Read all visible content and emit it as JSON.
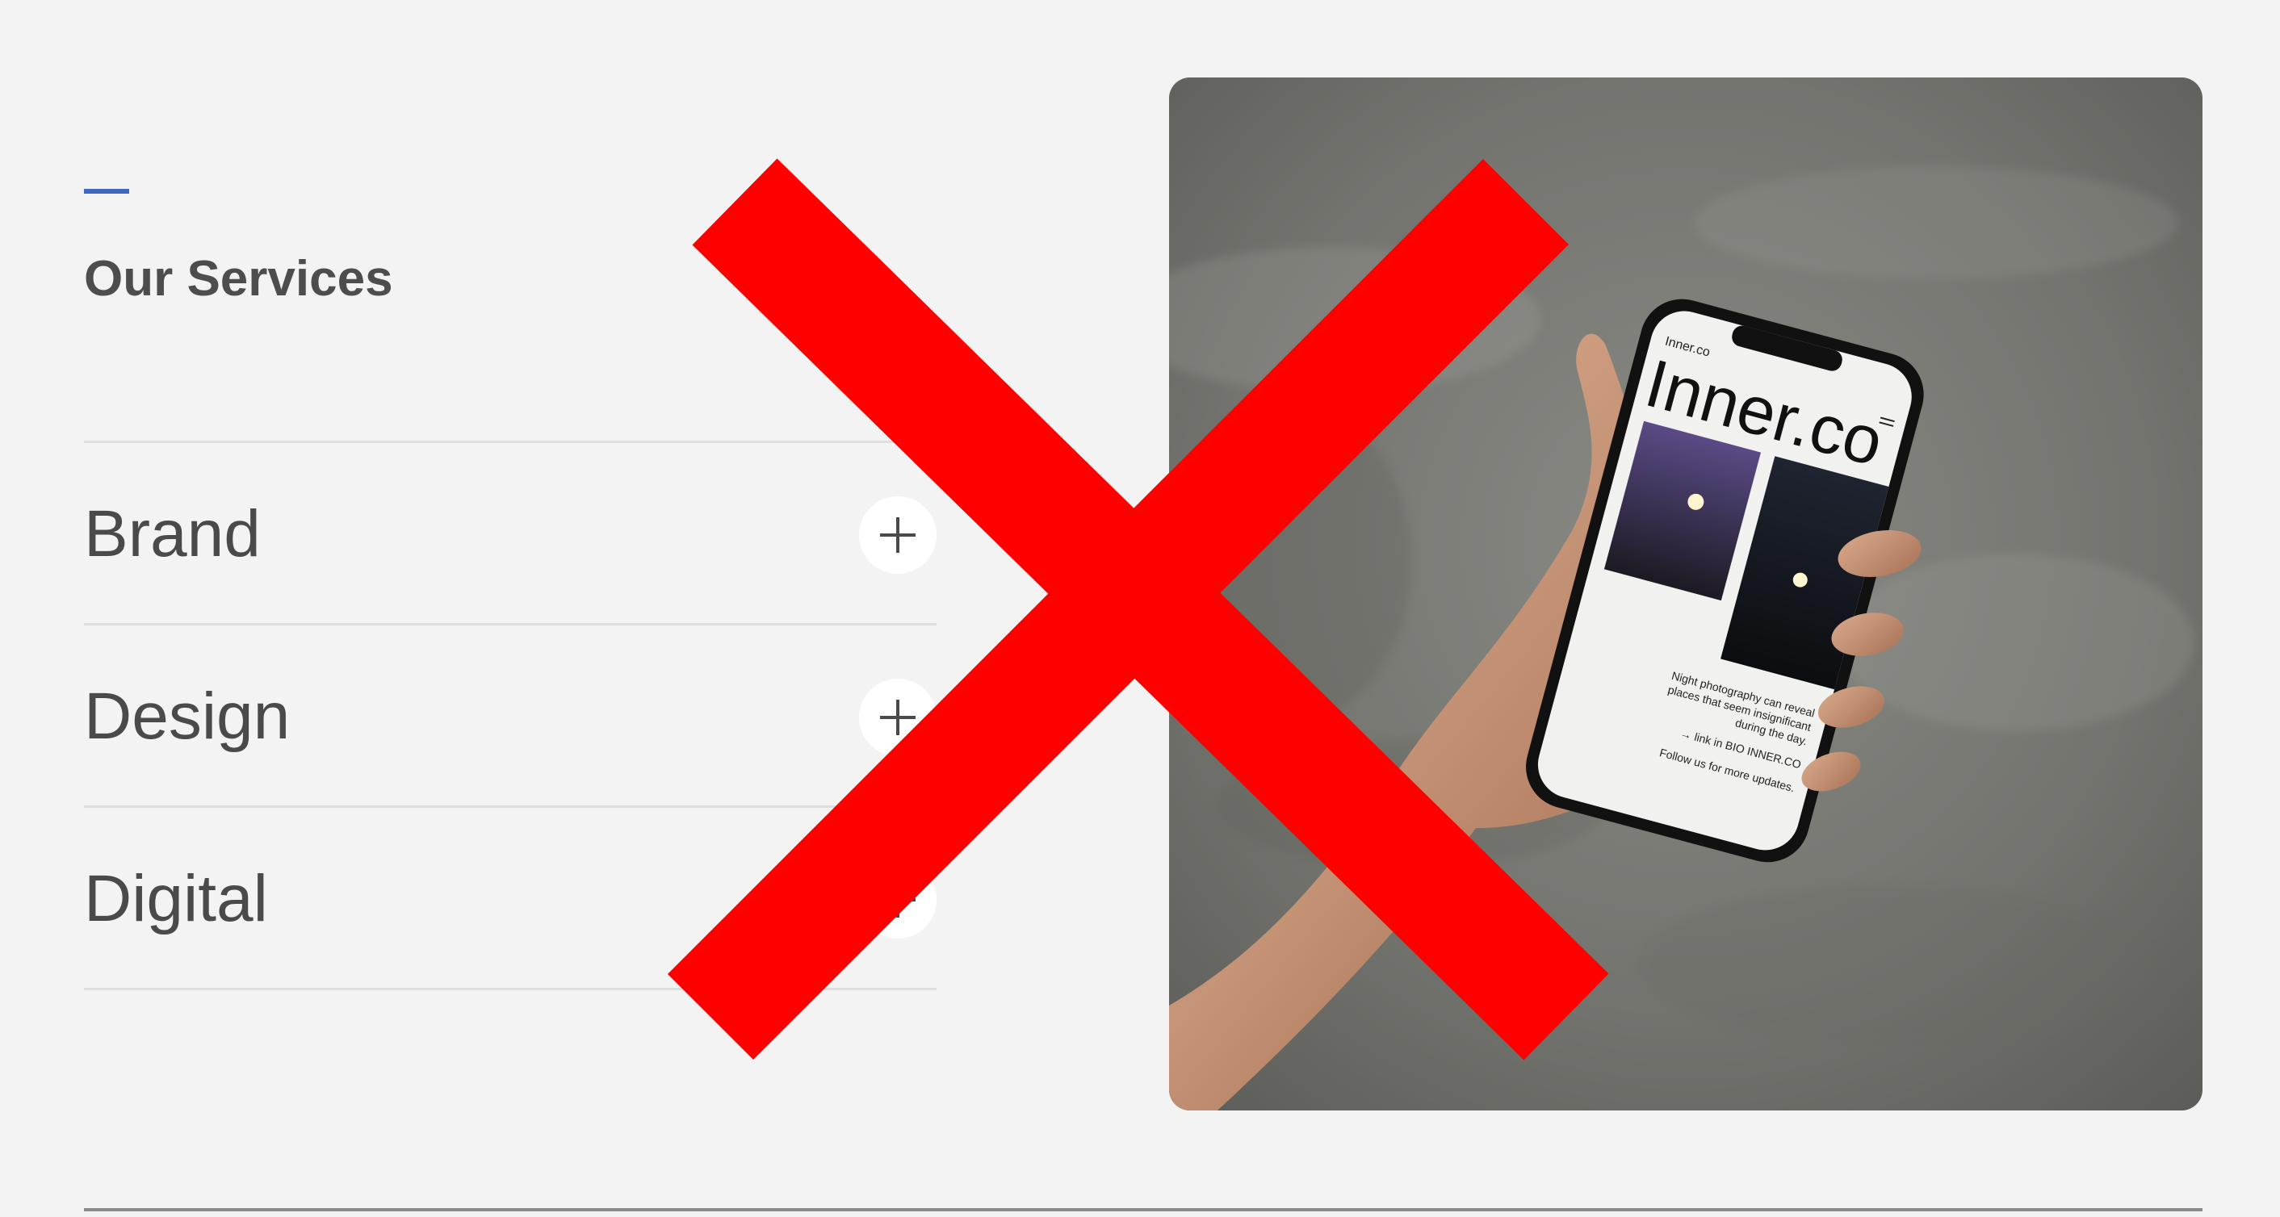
{
  "section": {
    "title": "Our Services",
    "accent_color": "#3f67c1"
  },
  "services": [
    {
      "label": "Brand",
      "icon": "plus-icon"
    },
    {
      "label": "Design",
      "icon": "plus-icon"
    },
    {
      "label": "Digital",
      "icon": "plus-icon"
    }
  ],
  "photo": {
    "subject": "hand-holding-phone",
    "phone_screen": {
      "small_brand": "Inner.co",
      "big_brand": "Inner.co",
      "caption_lines": [
        "Night photography can reveal",
        "places that seem insignificant",
        "during the day.",
        "→ link in BIO INNER.CO",
        "Follow us for more updates."
      ]
    }
  },
  "overlay": {
    "color": "#ff0000",
    "shape": "x-mark"
  }
}
